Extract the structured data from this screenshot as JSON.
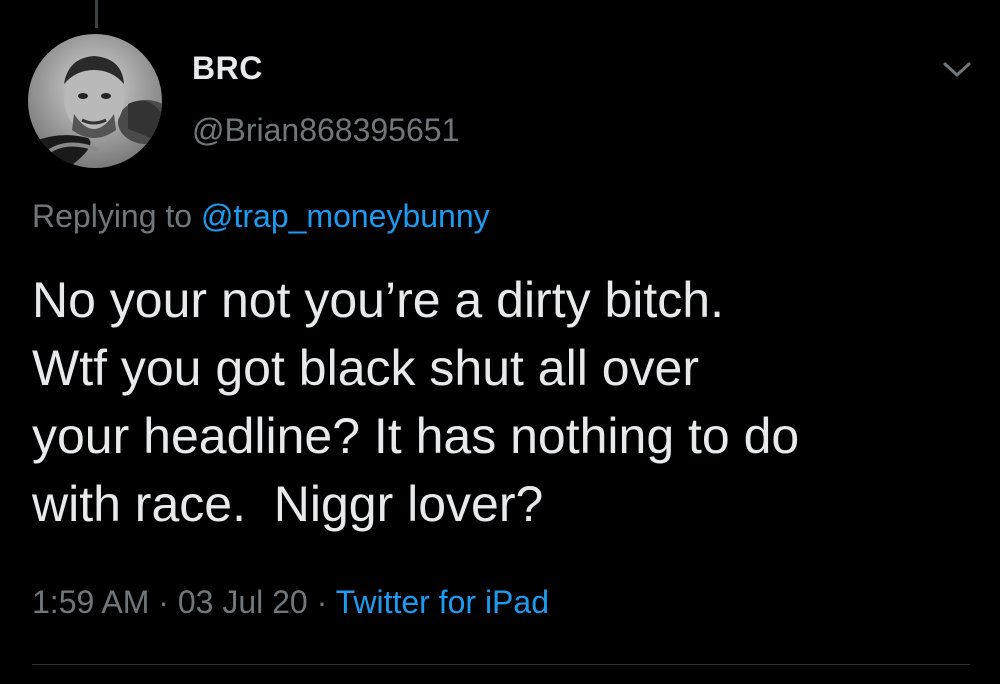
{
  "author": {
    "display_name": "BRC",
    "handle": "@Brian868395651"
  },
  "reply": {
    "prefix": "Replying to ",
    "mention": "@trap_moneybunny"
  },
  "tweet": {
    "lines": [
      "No your not you’re a dirty bitch.",
      "Wtf you got black shut all over",
      "your headline? It has nothing to do",
      "with race.  Niggr lover?"
    ]
  },
  "meta": {
    "time": "1:59 AM",
    "sep1": " · ",
    "date": "03 Jul 20",
    "sep2": " · ",
    "source": "Twitter for iPad"
  },
  "icons": {
    "more": "chevron-down-icon"
  },
  "colors": {
    "background": "#000000",
    "text": "#e7e9ea",
    "muted": "#71767b",
    "link": "#1d9bf0"
  }
}
